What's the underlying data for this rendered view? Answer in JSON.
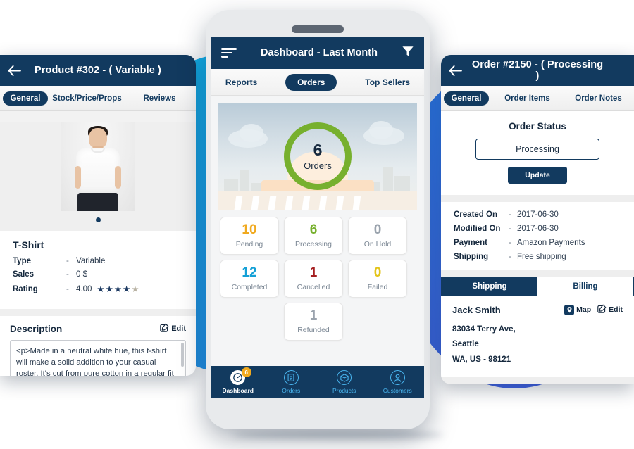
{
  "left_panel": {
    "header": {
      "back_icon": "back-arrow-icon",
      "title": "Product #302 - ( Variable )"
    },
    "tabs": [
      {
        "label": "General",
        "active": true
      },
      {
        "label": "Stock/Price/Props",
        "active": false
      },
      {
        "label": "Reviews",
        "active": false
      }
    ],
    "product": {
      "name": "T-Shirt",
      "fields": [
        {
          "key": "Type",
          "dash": "-",
          "value": "Variable"
        },
        {
          "key": "Sales",
          "dash": "-",
          "value": "0 $"
        },
        {
          "key": "Rating",
          "dash": "-",
          "value": "4.00"
        }
      ],
      "rating_stars_filled": 4,
      "rating_stars_total": 5
    },
    "description": {
      "title": "Description",
      "edit_label": "Edit",
      "edit_icon": "pencil-edit-icon",
      "text": "<p>Made in a neutral white hue, this t-shirt will make a solid addition to your casual roster. It's cut from pure cotton in a regular fit to keep you comfortable and has a round neck and short sleeves. Wear yours with anything,"
    }
  },
  "center_phone": {
    "header": {
      "menu_icon": "hamburger-menu-icon",
      "title": "Dashboard - Last Month",
      "filter_icon": "funnel-filter-icon"
    },
    "tabs": [
      {
        "label": "Reports",
        "active": false
      },
      {
        "label": "Orders",
        "active": true
      },
      {
        "label": "Top Sellers",
        "active": false
      }
    ],
    "hero": {
      "count": "6",
      "label": "Orders",
      "ring_color": "#77b02e"
    },
    "stats": [
      {
        "value": "10",
        "label": "Pending",
        "color": "#f0a91e"
      },
      {
        "value": "6",
        "label": "Processing",
        "color": "#77b02e"
      },
      {
        "value": "0",
        "label": "On Hold",
        "color": "#9aa3ad"
      },
      {
        "value": "12",
        "label": "Completed",
        "color": "#14a0d6"
      },
      {
        "value": "1",
        "label": "Cancelled",
        "color": "#a51f21"
      },
      {
        "value": "0",
        "label": "Failed",
        "color": "#e3c41a"
      },
      {
        "value": "1",
        "label": "Refunded",
        "color": "#9aa3ad"
      }
    ],
    "nav": [
      {
        "label": "Dashboard",
        "icon": "dashboard-gauge-icon",
        "active": true,
        "badge": "6"
      },
      {
        "label": "Orders",
        "icon": "orders-document-icon",
        "active": false,
        "badge": ""
      },
      {
        "label": "Products",
        "icon": "products-box-icon",
        "active": false,
        "badge": ""
      },
      {
        "label": "Customers",
        "icon": "customers-person-icon",
        "active": false,
        "badge": ""
      }
    ]
  },
  "right_panel": {
    "header": {
      "back_icon": "back-arrow-icon",
      "title": "Order #2150 - ( Processing )"
    },
    "tabs": [
      {
        "label": "General",
        "active": true
      },
      {
        "label": "Order Items",
        "active": false
      },
      {
        "label": "Order Notes",
        "active": false
      }
    ],
    "status": {
      "title": "Order Status",
      "selected": "Processing",
      "update_label": "Update"
    },
    "meta": [
      {
        "key": "Created On",
        "dash": "-",
        "value": "2017-06-30"
      },
      {
        "key": "Modified On",
        "dash": "-",
        "value": "2017-06-30"
      },
      {
        "key": "Payment",
        "dash": "-",
        "value": "Amazon Payments"
      },
      {
        "key": "Shipping",
        "dash": "-",
        "value": "Free shipping"
      }
    ],
    "address_tabs": [
      {
        "label": "Shipping",
        "active": true
      },
      {
        "label": "Billing",
        "active": false
      }
    ],
    "address": {
      "name": "Jack Smith",
      "map_label": "Map",
      "map_icon": "map-pin-icon",
      "edit_label": "Edit",
      "edit_icon": "pencil-edit-icon",
      "line1": "83034 Terry Ave,",
      "line2": "Seattle",
      "line3": "WA, US - 98121"
    }
  },
  "theme": {
    "navy": "#123a5f",
    "cyan_blob": "#19a6ef",
    "blue_blob": "#3a6fe8",
    "green": "#77b02e"
  }
}
